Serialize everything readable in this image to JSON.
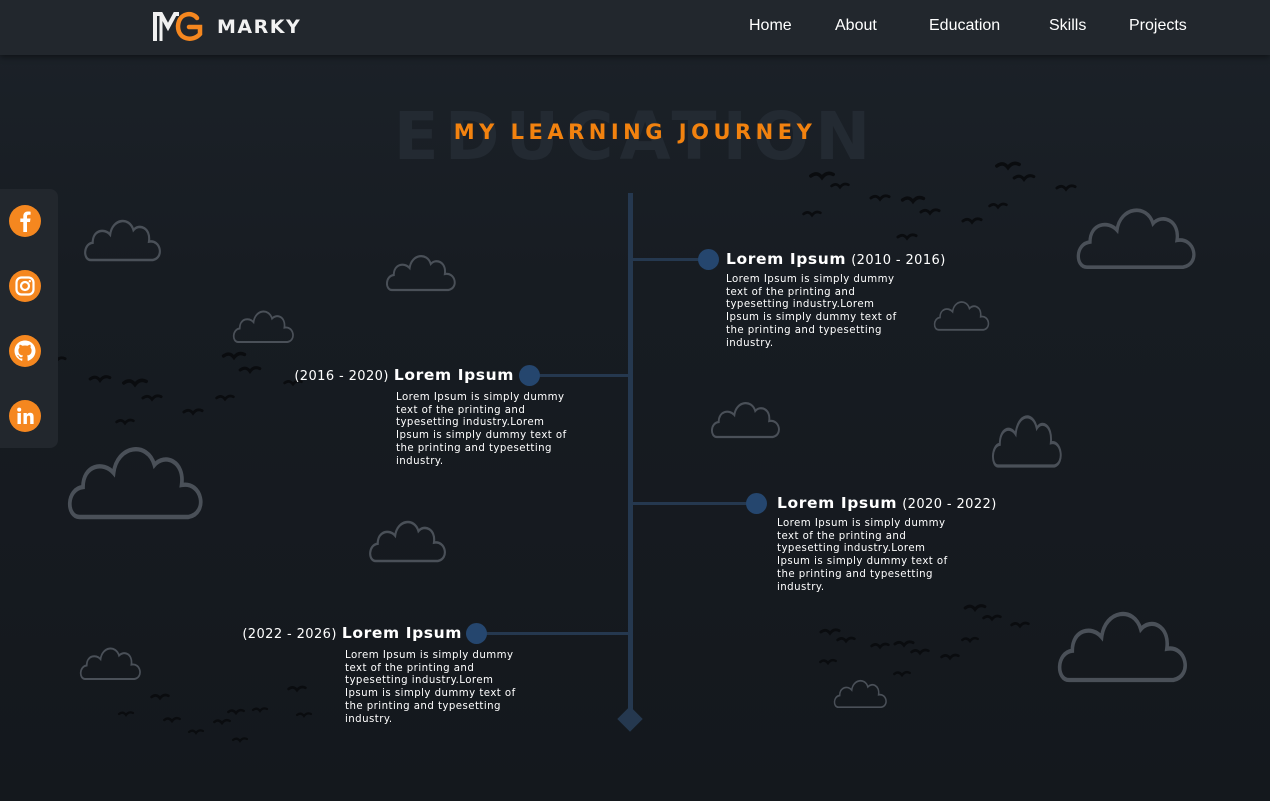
{
  "brand": {
    "logo_text": "MARKY"
  },
  "nav": {
    "items": [
      {
        "label": "Home"
      },
      {
        "label": "About"
      },
      {
        "label": "Education"
      },
      {
        "label": "Skills"
      },
      {
        "label": "Projects"
      }
    ]
  },
  "section": {
    "bg_title": "EDUCATION",
    "title": "MY LEARNING JOURNEY"
  },
  "social": [
    {
      "icon": "facebook-icon"
    },
    {
      "icon": "instagram-icon"
    },
    {
      "icon": "github-icon"
    },
    {
      "icon": "linkedin-icon"
    }
  ],
  "colors": {
    "accent": "#f2820f",
    "timeline": "#25384f",
    "dot": "#25466e",
    "navbar": "#22272d",
    "background": "#161b21"
  },
  "timeline": [
    {
      "side": "right",
      "title": "Lorem Ipsum",
      "date": "(2010 - 2016)",
      "desc": "Lorem Ipsum is simply dummy text of the printing and typesetting industry.Lorem Ipsum is simply dummy text of the printing and typesetting industry."
    },
    {
      "side": "left",
      "title": "Lorem Ipsum",
      "date": "(2016 - 2020)",
      "desc": "Lorem Ipsum is simply dummy text of the printing and typesetting industry.Lorem Ipsum is simply dummy text of the printing and typesetting industry."
    },
    {
      "side": "right",
      "title": "Lorem Ipsum",
      "date": "(2020 - 2022)",
      "desc": "Lorem Ipsum is simply dummy text of the printing and typesetting industry.Lorem Ipsum is simply dummy text of the printing and typesetting industry."
    },
    {
      "side": "left",
      "title": "Lorem Ipsum",
      "date": "(2022 - 2026)",
      "desc": "Lorem Ipsum is simply dummy text of the printing and typesetting industry.Lorem Ipsum is simply dummy text of the printing and typesetting industry."
    }
  ]
}
